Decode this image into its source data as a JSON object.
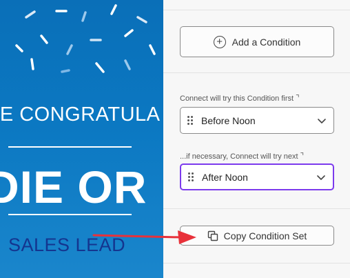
{
  "graphic": {
    "line1": "SE CONGRATULA",
    "line2": "DIE OR",
    "line3": "SALES LEAD"
  },
  "panel": {
    "add_condition": {
      "label": "Add a Condition",
      "icon": "plus-circle-icon"
    },
    "first_caption": "Connect will try this Condition first",
    "first_select": {
      "value": "Before Noon",
      "icon": "chevron-down-icon"
    },
    "next_caption": "...if necessary, Connect will try next",
    "next_select": {
      "value": "After Noon",
      "icon": "chevron-down-icon"
    },
    "copy_set": {
      "label": "Copy Condition Set",
      "icon": "copy-icon"
    }
  },
  "colors": {
    "graphic_blue": "#0b78c2",
    "sales_lead_navy": "#14358f",
    "focus_purple": "#7c3aed",
    "arrow_red": "#e8313a"
  }
}
